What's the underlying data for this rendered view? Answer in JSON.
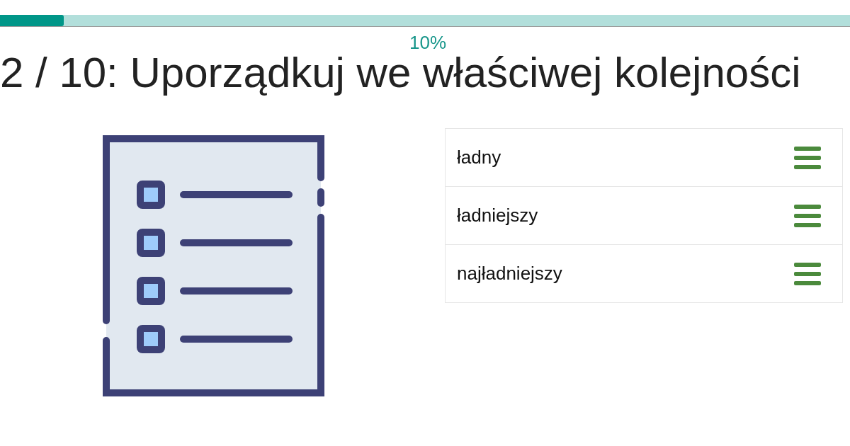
{
  "progress": {
    "level": 0.075,
    "label": "10%"
  },
  "title": "2 / 10: Uporządkuj we właściwej kolejności",
  "items": [
    {
      "text": "ładny"
    },
    {
      "text": "ładniejszy"
    },
    {
      "text": "najładniejszy"
    }
  ]
}
